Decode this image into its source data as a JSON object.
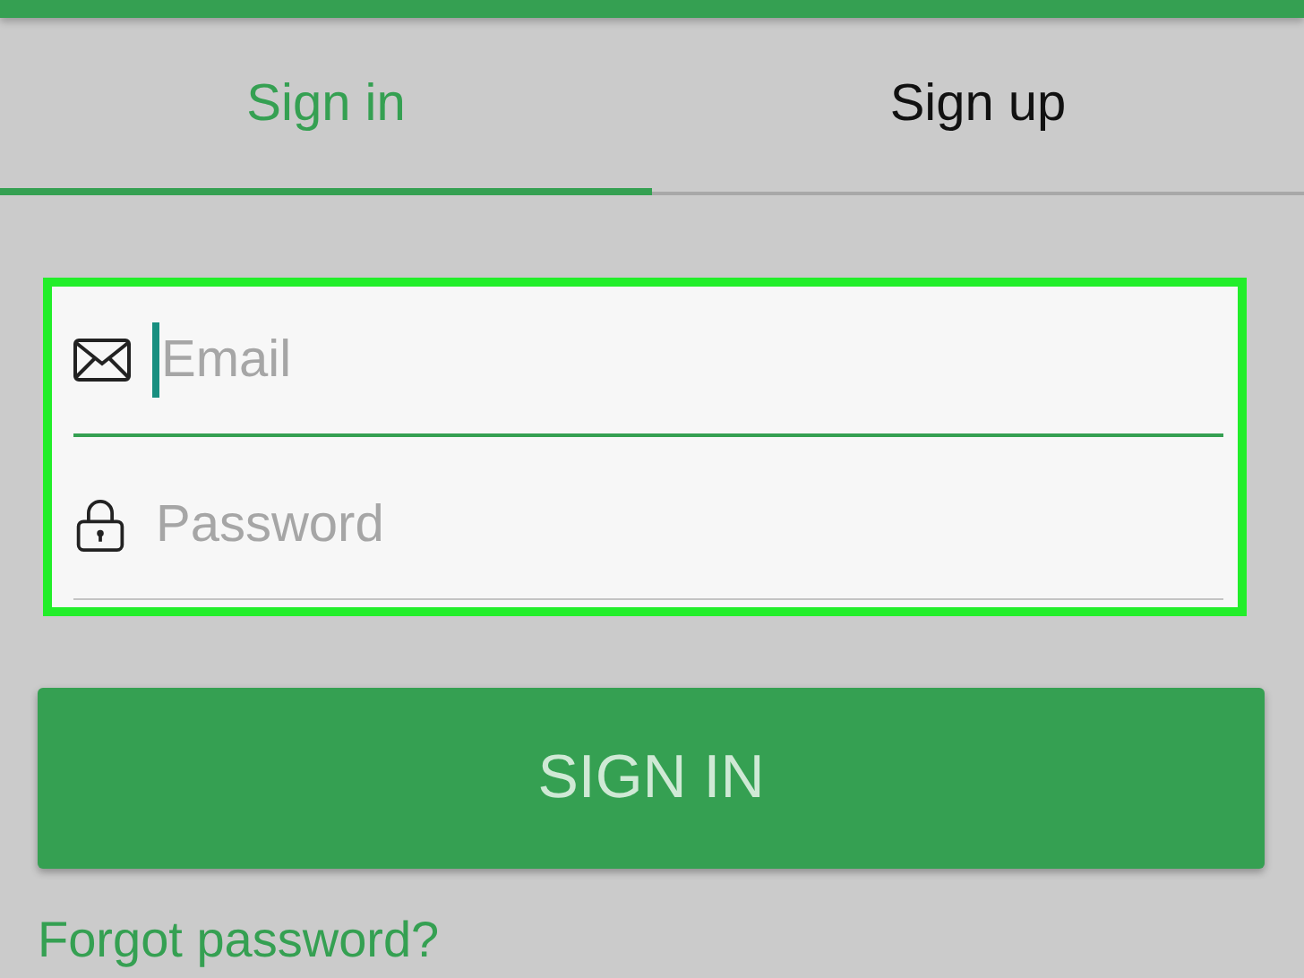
{
  "tabs": [
    {
      "label": "Sign in",
      "selected": true
    },
    {
      "label": "Sign up",
      "selected": false
    }
  ],
  "form": {
    "highlighted": true,
    "fields": [
      {
        "kind": "email",
        "placeholder": "Email",
        "focused": true
      },
      {
        "kind": "password",
        "placeholder": "Password",
        "focused": false
      }
    ]
  },
  "submit_button": {
    "label": "SIGN IN"
  },
  "forgot_link": "Forgot password?"
}
